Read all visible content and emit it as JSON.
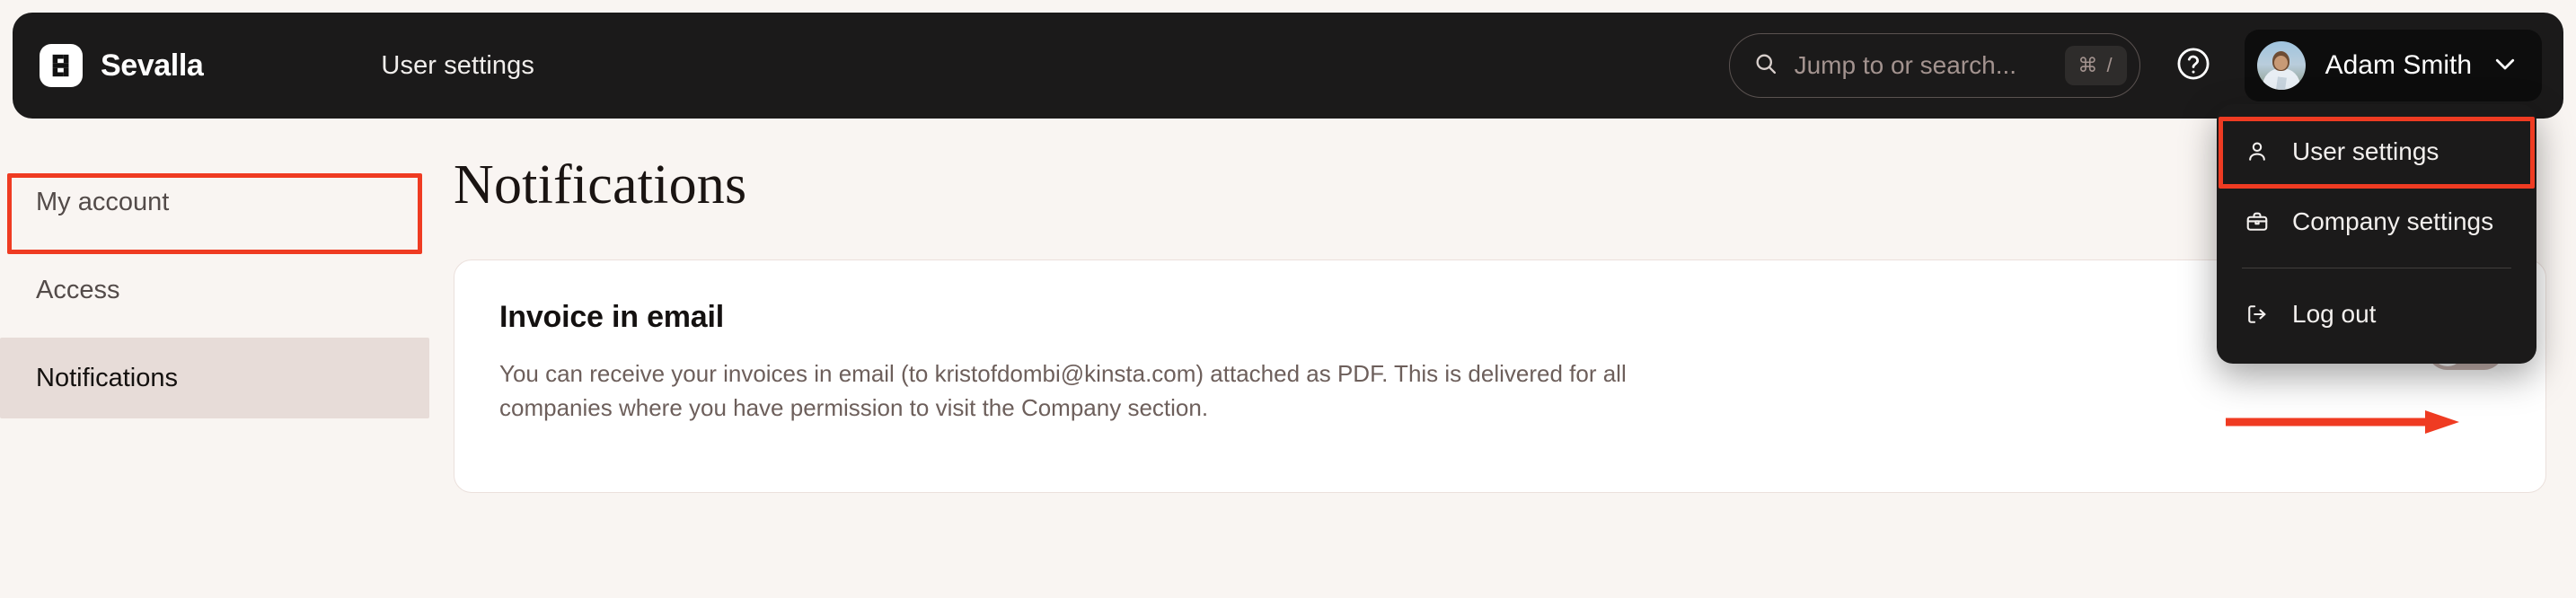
{
  "topbar": {
    "brand_name": "Sevalla",
    "brand_logo_icon": "sevalla-s-logo",
    "page_nav_title": "User settings",
    "search": {
      "placeholder": "Jump to or search...",
      "shortcut": "⌘ /",
      "icon": "search-icon"
    },
    "help_icon": "question-circle-icon",
    "user": {
      "name": "Adam Smith",
      "avatar_icon": "user-avatar-photo",
      "chevron_icon": "chevron-down-icon"
    }
  },
  "user_menu": {
    "items": [
      {
        "label": "User settings",
        "icon": "person-icon",
        "highlighted": true
      },
      {
        "label": "Company settings",
        "icon": "briefcase-icon",
        "highlighted": false
      },
      {
        "label": "Log out",
        "icon": "logout-icon",
        "highlighted": false
      }
    ]
  },
  "sidebar": {
    "items": [
      {
        "label": "My account",
        "active": false
      },
      {
        "label": "Access",
        "active": false
      },
      {
        "label": "Notifications",
        "active": true
      }
    ]
  },
  "main": {
    "page_title": "Notifications",
    "card": {
      "title": "Invoice in email",
      "description": "You can receive your invoices in email (to kristofdombi@kinsta.com) attached as PDF. This is delivered for all companies where you have permission to visit the Company section.",
      "toggle": {
        "name": "invoice-in-email-toggle",
        "state": "off"
      }
    }
  },
  "annotations": {
    "highlight_color": "#ef3b22",
    "arrow_color": "#ef3b22"
  },
  "colors": {
    "page_background": "#f9f5f2",
    "topbar_background": "#1b1a1a",
    "card_background": "#ffffff",
    "sidebar_active_background": "#e7dcd8",
    "toggle_off_track": "#c6b3ae"
  }
}
